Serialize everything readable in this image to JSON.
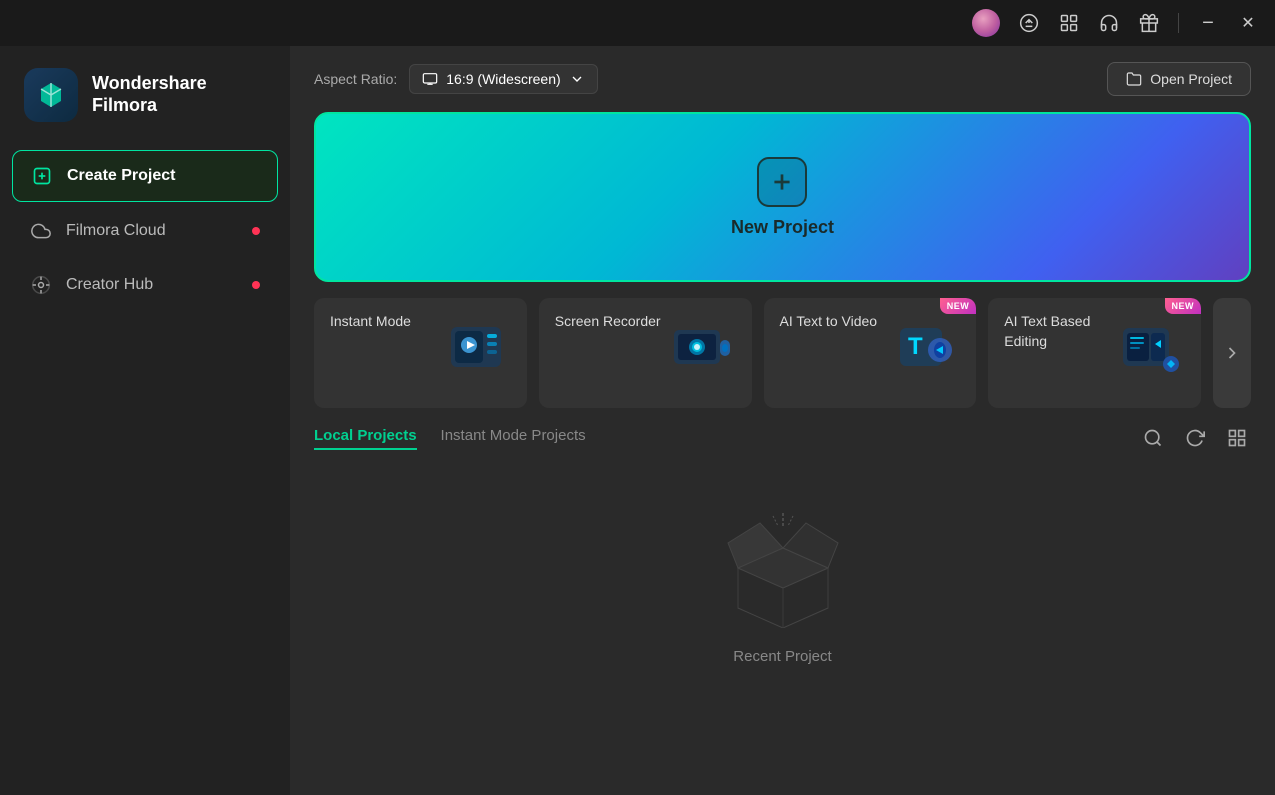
{
  "titlebar": {
    "minimize_label": "−",
    "close_label": "✕"
  },
  "sidebar": {
    "logo_title_line1": "Wondershare",
    "logo_title_line2": "Filmora",
    "nav_items": [
      {
        "id": "create-project",
        "label": "Create Project",
        "active": true,
        "badge": false
      },
      {
        "id": "filmora-cloud",
        "label": "Filmora Cloud",
        "active": false,
        "badge": true
      },
      {
        "id": "creator-hub",
        "label": "Creator Hub",
        "active": false,
        "badge": true
      }
    ]
  },
  "toolbar": {
    "aspect_ratio_label": "Aspect Ratio:",
    "aspect_ratio_value": "16:9 (Widescreen)",
    "open_project_label": "Open Project"
  },
  "new_project": {
    "label": "New Project"
  },
  "quick_cards": [
    {
      "id": "instant-mode",
      "label": "Instant Mode",
      "badge": false
    },
    {
      "id": "screen-recorder",
      "label": "Screen Recorder",
      "badge": false
    },
    {
      "id": "ai-text-to-video",
      "label": "AI Text to Video",
      "badge": true
    },
    {
      "id": "ai-text-based-editing",
      "label": "AI Text Based Editing",
      "badge": true
    }
  ],
  "projects": {
    "tabs": [
      {
        "id": "local-projects",
        "label": "Local Projects",
        "active": true
      },
      {
        "id": "instant-mode-projects",
        "label": "Instant Mode Projects",
        "active": false
      }
    ],
    "empty_label": "Recent Project"
  },
  "colors": {
    "accent": "#00e5a0",
    "accent_secondary": "#00c090",
    "badge_red": "#ff3355",
    "new_badge_gradient_start": "#ff6090",
    "new_badge_gradient_end": "#c030c0"
  }
}
